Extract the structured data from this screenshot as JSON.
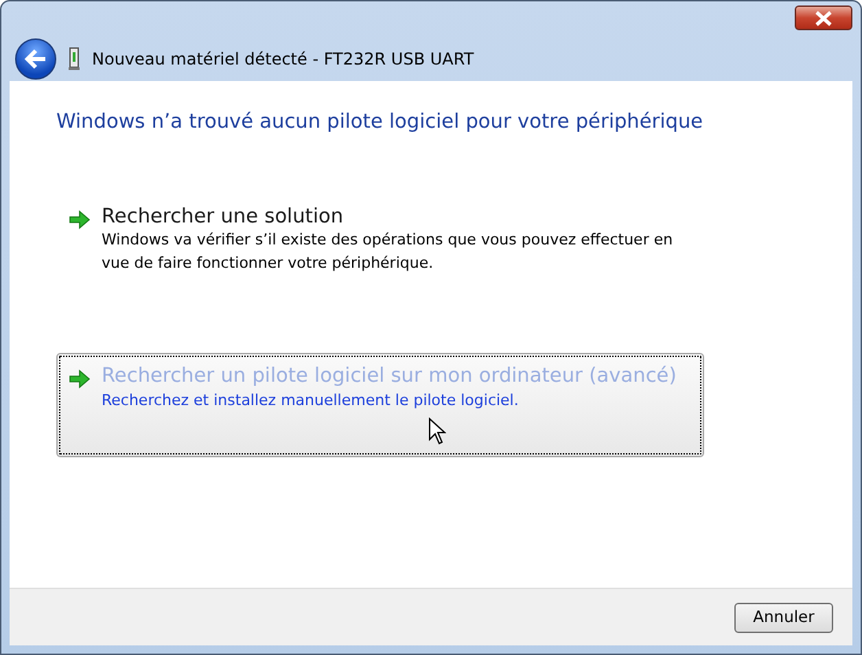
{
  "window": {
    "title": "Nouveau matériel détecté - FT232R USB UART"
  },
  "heading": "Windows n’a trouvé aucun pilote logiciel pour votre périphérique",
  "options": [
    {
      "title": "Rechercher une solution",
      "description": "Windows va vérifier s’il existe des opérations que vous pouvez effectuer en vue de faire fonctionner votre périphérique.",
      "selected": false
    },
    {
      "title": "Rechercher un pilote logiciel sur mon ordinateur (avancé)",
      "description": "Recherchez et installez manuellement le pilote logiciel.",
      "selected": true
    }
  ],
  "buttons": [
    "Annuler"
  ]
}
